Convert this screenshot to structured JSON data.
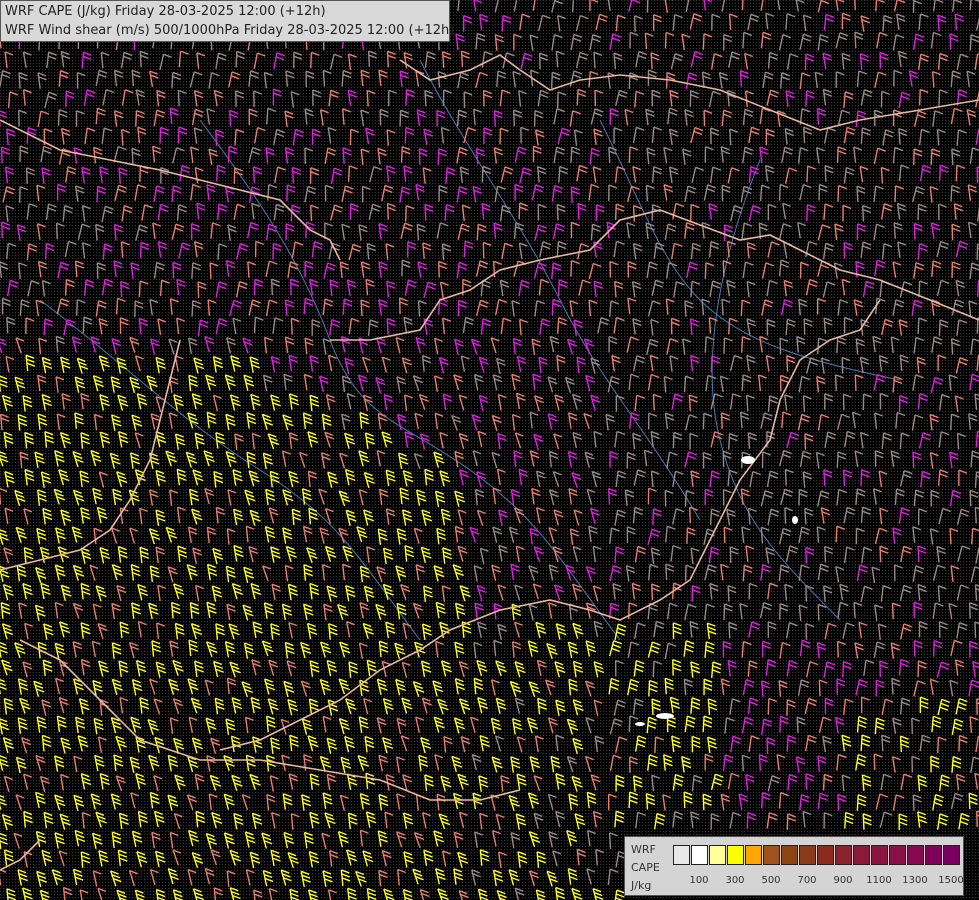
{
  "title": {
    "line1": "WRF CAPE (J/kg) Friday 28-03-2025 12:00 (+12h)",
    "line2": "WRF Wind shear (m/s) 500/1000hPa Friday 28-03-2025 12:00 (+12h)"
  },
  "legend": {
    "name_line1": "WRF",
    "name_line2": "CAPE",
    "unit": "J/kg",
    "colors": [
      "#e8e8e8",
      "#ffffff",
      "#ffff99",
      "#ffff00",
      "#ffa500",
      "#a0521c",
      "#8b4513",
      "#8b3a1a",
      "#8b2a20",
      "#8b2230",
      "#8b1a38",
      "#8b1540",
      "#8b1048",
      "#860a50",
      "#800058",
      "#7a0060"
    ],
    "tick_labels": [
      "100",
      "300",
      "500",
      "700",
      "900",
      "1100",
      "1300",
      "1500"
    ]
  },
  "colors": {
    "background": "#000000",
    "barb_grey": "#9a8a8a",
    "barb_salmon": "#e88070",
    "barb_magenta": "#e020e0",
    "barb_yellow": "#ffff20",
    "border": "#e8b8a0",
    "river": "#4a7ab0"
  }
}
